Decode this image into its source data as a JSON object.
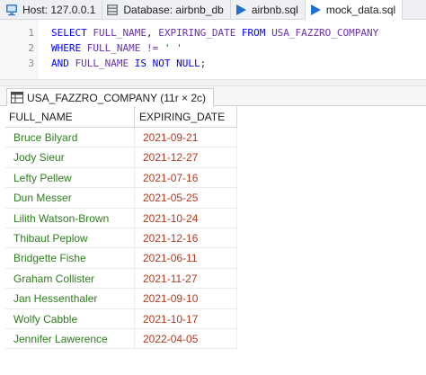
{
  "tabs": {
    "host": "Host: 127.0.0.1",
    "database": "Database: airbnb_db",
    "file1": "airbnb.sql",
    "file2": "mock_data.sql"
  },
  "editor": {
    "lines": [
      {
        "num": "1",
        "tokens": [
          {
            "t": "SELECT ",
            "c": "kw"
          },
          {
            "t": "FULL_NAME",
            "c": "id"
          },
          {
            "t": ", ",
            "c": "pl"
          },
          {
            "t": "EXPIRING_DATE",
            "c": "id"
          },
          {
            "t": " FROM ",
            "c": "kw"
          },
          {
            "t": "USA_FAZZRO_COMPANY",
            "c": "id"
          }
        ]
      },
      {
        "num": "2",
        "tokens": [
          {
            "t": "WHERE ",
            "c": "kw"
          },
          {
            "t": "FULL_NAME",
            "c": "id"
          },
          {
            "t": " != ",
            "c": "op"
          },
          {
            "t": "' '",
            "c": "str"
          }
        ]
      },
      {
        "num": "3",
        "tokens": [
          {
            "t": "AND ",
            "c": "kw"
          },
          {
            "t": "FULL_NAME",
            "c": "id"
          },
          {
            "t": " IS NOT NULL",
            "c": "kw"
          },
          {
            "t": ";",
            "c": "pl"
          }
        ]
      }
    ]
  },
  "result": {
    "tab_label": "USA_FAZZRO_COMPANY (11r × 2c)",
    "columns": [
      "FULL_NAME",
      "EXPIRING_DATE"
    ],
    "rows": [
      [
        "Bruce Bilyard",
        "2021-09-21"
      ],
      [
        "Jody Sieur",
        "2021-12-27"
      ],
      [
        "Lefty Pellew",
        "2021-07-16"
      ],
      [
        "Dun Messer",
        "2021-05-25"
      ],
      [
        "Lilith Watson-Brown",
        "2021-10-24"
      ],
      [
        "Thibaut Peplow",
        "2021-12-16"
      ],
      [
        "Bridgette Fishe",
        "2021-06-11"
      ],
      [
        "Graham Collister",
        "2021-11-27"
      ],
      [
        "Jan Hessenthaler",
        "2021-09-10"
      ],
      [
        "Wolfy Cabble",
        "2021-10-17"
      ],
      [
        "Jennifer Lawerence",
        "2022-04-05"
      ]
    ]
  },
  "colors": {
    "keyword": "#0000ff",
    "identifier": "#6b2fb0",
    "string": "#008000",
    "name_cell": "#2e7d1e",
    "date_cell": "#b23a1f"
  }
}
